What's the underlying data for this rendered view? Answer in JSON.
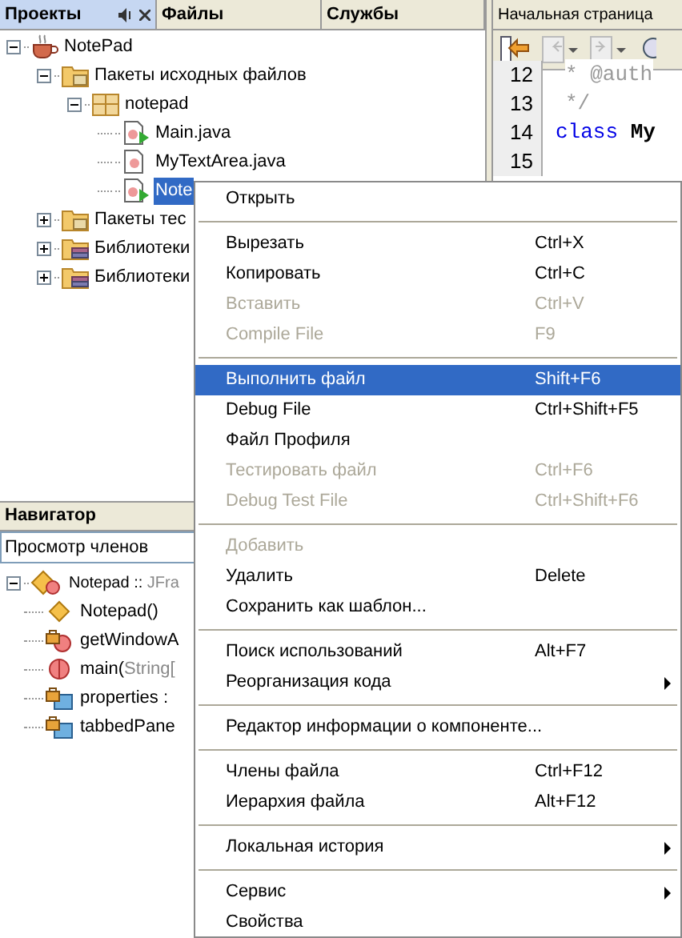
{
  "projects_panel": {
    "tabs": [
      {
        "label": "Проекты",
        "selected": true
      },
      {
        "label": "Файлы",
        "selected": false
      },
      {
        "label": "Службы",
        "selected": false
      }
    ],
    "tree": [
      {
        "label": "NotePad",
        "kind": "project",
        "expanded": true,
        "selected": false,
        "children": [
          {
            "label": "Пакеты исходных файлов",
            "kind": "source-folder",
            "expanded": true,
            "selected": false,
            "children": [
              {
                "label": "notepad",
                "kind": "package",
                "expanded": true,
                "selected": false,
                "children": [
                  {
                    "label": "Main.java",
                    "kind": "runnable-class",
                    "selected": false
                  },
                  {
                    "label": "MyTextArea.java",
                    "kind": "class",
                    "selected": false
                  },
                  {
                    "label": "Note",
                    "kind": "runnable-class",
                    "selected": true
                  }
                ]
              }
            ]
          },
          {
            "label": "Пакеты тес",
            "kind": "source-folder",
            "expanded": false,
            "selected": false
          },
          {
            "label": "Библиотеки",
            "kind": "library",
            "expanded": false,
            "selected": false
          },
          {
            "label": "Библиотеки",
            "kind": "library",
            "expanded": false,
            "selected": false
          }
        ]
      }
    ]
  },
  "navigator": {
    "title": "Навигатор",
    "view": "Просмотр членов",
    "root": {
      "label": "Notepad :: ",
      "detail": "JFra",
      "expanded": true
    },
    "members": [
      {
        "label": "Notepad()",
        "kind": "constructor"
      },
      {
        "label": "getWindowA",
        "kind": "private-method"
      },
      {
        "label": "main(",
        "detail": "String[",
        "kind": "static-method"
      },
      {
        "label": "properties :",
        "kind": "private-field"
      },
      {
        "label": "tabbedPane",
        "kind": "private-field"
      }
    ]
  },
  "editor": {
    "tab": "Начальная страница",
    "lines": [
      {
        "number": "12",
        "code": "* @auth",
        "kind": "comment"
      },
      {
        "number": "13",
        "code": "*/",
        "kind": "comment"
      },
      {
        "number": "14",
        "keyword": "class",
        "code": "My",
        "kind": "code"
      },
      {
        "number": "15",
        "kind": "blank"
      }
    ]
  },
  "context_menu": [
    {
      "kind": "item",
      "label": "Открыть",
      "disabled": false,
      "selected": false
    },
    {
      "kind": "separator"
    },
    {
      "kind": "item",
      "label": "Вырезать",
      "shortcut": "Ctrl+X",
      "disabled": false,
      "selected": false
    },
    {
      "kind": "item",
      "label": "Копировать",
      "shortcut": "Ctrl+C",
      "disabled": false,
      "selected": false
    },
    {
      "kind": "item",
      "label": "Вставить",
      "shortcut": "Ctrl+V",
      "disabled": true,
      "selected": false
    },
    {
      "kind": "item",
      "label": "Compile File",
      "shortcut": "F9",
      "disabled": true,
      "selected": false
    },
    {
      "kind": "separator"
    },
    {
      "kind": "item",
      "label": "Выполнить файл",
      "shortcut": "Shift+F6",
      "disabled": false,
      "selected": true
    },
    {
      "kind": "item",
      "label": "Debug File",
      "shortcut": "Ctrl+Shift+F5",
      "disabled": false,
      "selected": false
    },
    {
      "kind": "item",
      "label": "Файл Профиля",
      "disabled": false,
      "selected": false
    },
    {
      "kind": "item",
      "label": "Тестировать файл",
      "shortcut": "Ctrl+F6",
      "disabled": true,
      "selected": false
    },
    {
      "kind": "item",
      "label": "Debug Test File",
      "shortcut": "Ctrl+Shift+F6",
      "disabled": true,
      "selected": false
    },
    {
      "kind": "separator"
    },
    {
      "kind": "item",
      "label": "Добавить",
      "disabled": true,
      "selected": false
    },
    {
      "kind": "item",
      "label": "Удалить",
      "shortcut": "Delete",
      "disabled": false,
      "selected": false
    },
    {
      "kind": "item",
      "label": "Сохранить как шаблон...",
      "disabled": false,
      "selected": false
    },
    {
      "kind": "separator"
    },
    {
      "kind": "item",
      "label": "Поиск использований",
      "shortcut": "Alt+F7",
      "disabled": false,
      "selected": false
    },
    {
      "kind": "item",
      "label": "Реорганизация кода",
      "submenu": true,
      "disabled": false,
      "selected": false
    },
    {
      "kind": "separator"
    },
    {
      "kind": "item",
      "label": "Редактор информации о компоненте...",
      "disabled": false,
      "selected": false
    },
    {
      "kind": "separator"
    },
    {
      "kind": "item",
      "label": "Члены файла",
      "shortcut": "Ctrl+F12",
      "disabled": false,
      "selected": false
    },
    {
      "kind": "item",
      "label": "Иерархия файла",
      "shortcut": "Alt+F12",
      "disabled": false,
      "selected": false
    },
    {
      "kind": "separator"
    },
    {
      "kind": "item",
      "label": "Локальная история",
      "submenu": true,
      "disabled": false,
      "selected": false
    },
    {
      "kind": "separator"
    },
    {
      "kind": "item",
      "label": "Сервис",
      "submenu": true,
      "disabled": false,
      "selected": false
    },
    {
      "kind": "item",
      "label": "Свойства",
      "disabled": false,
      "selected": false
    }
  ]
}
